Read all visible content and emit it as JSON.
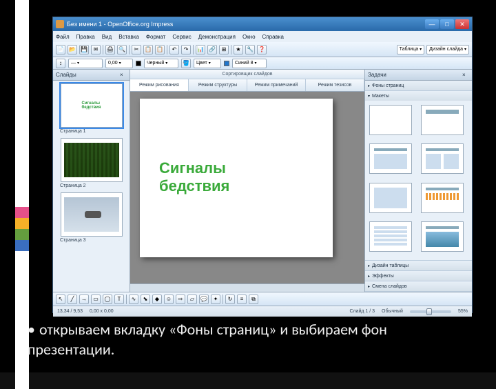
{
  "caption_text": "открываем вкладку «Фоны страниц» и выбираем фон презентации.",
  "bullet": "•",
  "titlebar": {
    "app": "Без имени 1 - OpenOffice.org Impress"
  },
  "menu": [
    "Файл",
    "Правка",
    "Вид",
    "Вставка",
    "Формат",
    "Сервис",
    "Демонстрация",
    "Окно",
    "Справка"
  ],
  "panels": {
    "slides": "Слайды",
    "tasks": "Задачи",
    "sort_header": "Сортировщик слайдов"
  },
  "view_tabs": [
    "Режим рисования",
    "Режим структуры",
    "Режим примечаний",
    "Режим тезисов"
  ],
  "slide_text_l1": "Сигналы",
  "slide_text_l2": "бедствия",
  "thumb_labels": [
    "Страница 1",
    "Страница 2",
    "Страница 3"
  ],
  "task_sections": [
    "Фоны страниц",
    "Макеты",
    "Дизайн таблицы",
    "Эффекты",
    "Смена слайдов"
  ],
  "toolbar2": {
    "black": "Черный",
    "color": "Цвет",
    "blue": "Синий 8",
    "tables": "Таблица",
    "design": "Дизайн слайда"
  },
  "status": {
    "coords": "13,34 / 9,53",
    "size": "0,00 x 0,00",
    "page": "Слайд 1 / 3",
    "layout": "Обычный",
    "zoom": "55%"
  },
  "icons": {
    "minimize": "—",
    "maximize": "□",
    "close": "✕",
    "chev": "▾",
    "tri_r": "▸",
    "tri_d": "▾",
    "panel_close": "×",
    "tools_icons": [
      "📄",
      "📂",
      "💾",
      "✉",
      "🖨",
      "🔍",
      "✂",
      "📋",
      "📋",
      "↶",
      "↷",
      "📊",
      "🔗",
      "⊞",
      "★",
      "🔧",
      "❓"
    ]
  }
}
